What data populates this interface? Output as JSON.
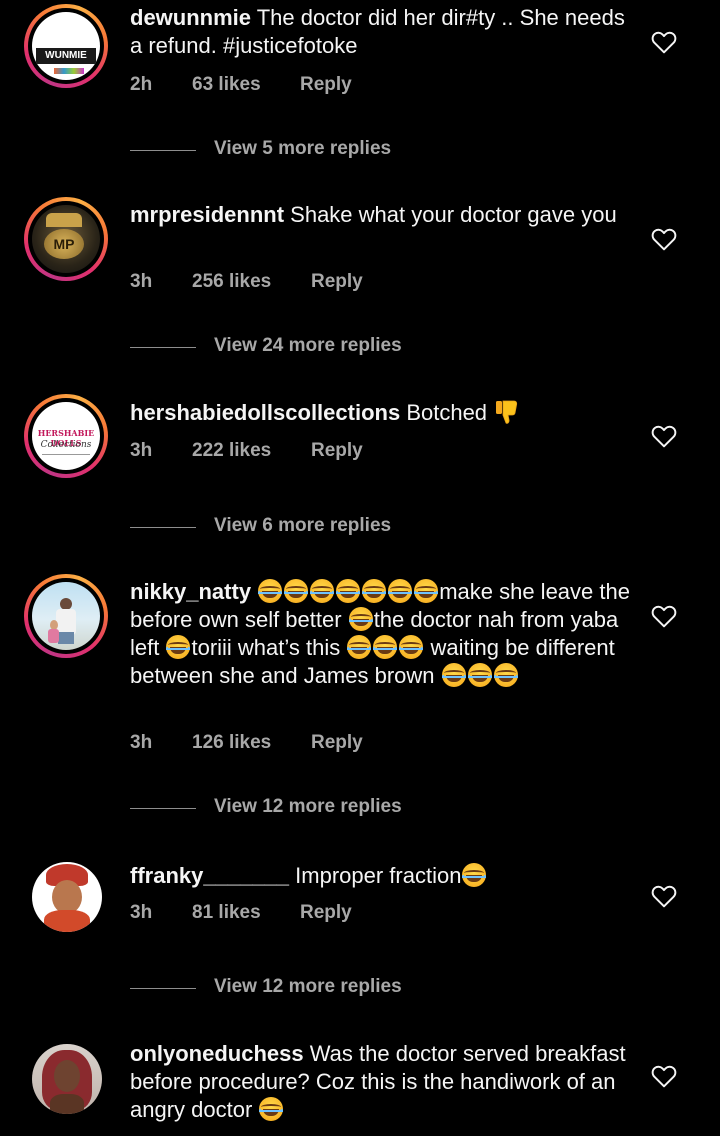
{
  "comments": [
    {
      "username": "dewunnmie",
      "text": "The doctor did her dir#ty .. She needs a refund. #justicefotoke",
      "time": "2h",
      "likes": "63 likes",
      "reply": "Reply",
      "view_replies": "View 5 more replies",
      "avatar_label": "WUNMIE"
    },
    {
      "username": "mrpresidennnt",
      "text": "Shake what your doctor gave you",
      "time": "3h",
      "likes": "256 likes",
      "reply": "Reply",
      "view_replies": "View 24 more replies",
      "avatar_label": "MP"
    },
    {
      "username": "hershabiedollscollections",
      "text": "Botched",
      "time": "3h",
      "likes": "222 likes",
      "reply": "Reply",
      "view_replies": "View 6 more replies",
      "avatar_label": "HERSHABIE DOLLS",
      "avatar_sublabel": "Collections"
    },
    {
      "username": "nikky_natty",
      "text_parts": [
        "make she leave the before own self better ",
        "the doctor nah from yaba left ",
        "toriii what’s this ",
        "waiting be different between she and James brown "
      ],
      "time": "3h",
      "likes": "126 likes",
      "reply": "Reply",
      "view_replies": "View 12 more replies"
    },
    {
      "username": "ffranky_______",
      "text": "Improper fraction",
      "time": "3h",
      "likes": "81 likes",
      "reply": "Reply",
      "view_replies": "View 12 more replies"
    },
    {
      "username": "onlyoneduchess",
      "text": "Was the doctor served breakfast before procedure? Coz this is the handiwork of an angry doctor",
      "time": "",
      "likes": "",
      "reply": ""
    }
  ],
  "icons": {
    "like": "heart-outline-icon",
    "laugh": "face-with-tears-of-joy-emoji",
    "thumbs_down": "thumbs-down-emoji"
  },
  "colors": {
    "background": "#000000",
    "text": "#f5f5f5",
    "meta": "#a8a8a8",
    "story_ring_start": "#c13584",
    "story_ring_end": "#fcaf45"
  }
}
